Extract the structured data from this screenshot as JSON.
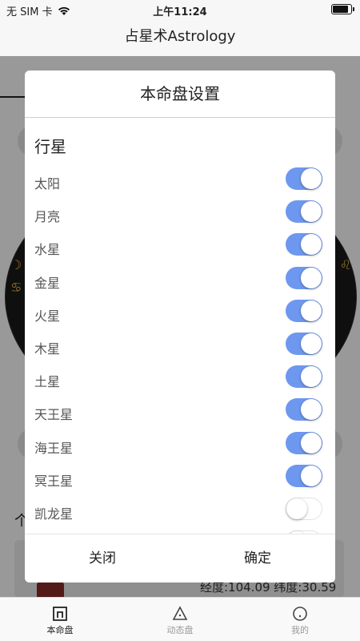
{
  "status_bar": {
    "carrier": "无 SIM 卡",
    "time": "上午11:24",
    "wifi_icon": "wifi-icon",
    "battery_icon": "battery-icon"
  },
  "nav": {
    "title": "占星术Astrology"
  },
  "background": {
    "section_label": "个",
    "coords": "经度:104.09 纬度:30.59"
  },
  "dialog": {
    "title": "本命盘设置",
    "section_title": "行星",
    "planets": [
      {
        "label": "太阳",
        "on": true
      },
      {
        "label": "月亮",
        "on": true
      },
      {
        "label": "水星",
        "on": true
      },
      {
        "label": "金星",
        "on": true
      },
      {
        "label": "火星",
        "on": true
      },
      {
        "label": "木星",
        "on": true
      },
      {
        "label": "土星",
        "on": true
      },
      {
        "label": "天王星",
        "on": true
      },
      {
        "label": "海王星",
        "on": true
      },
      {
        "label": "冥王星",
        "on": true
      },
      {
        "label": "凯龙星",
        "on": false
      },
      {
        "label": "",
        "on": false
      }
    ],
    "close_label": "关闭",
    "confirm_label": "确定"
  },
  "tabbar": {
    "items": [
      {
        "label": "本命盘",
        "icon": "natal-chart-icon",
        "active": true
      },
      {
        "label": "动态盘",
        "icon": "triangle-icon",
        "active": false
      },
      {
        "label": "我的",
        "icon": "profile-icon",
        "active": false
      }
    ]
  },
  "colors": {
    "switch_on": "#6e98ef",
    "overlay": "rgba(0,0,0,0.4)"
  }
}
